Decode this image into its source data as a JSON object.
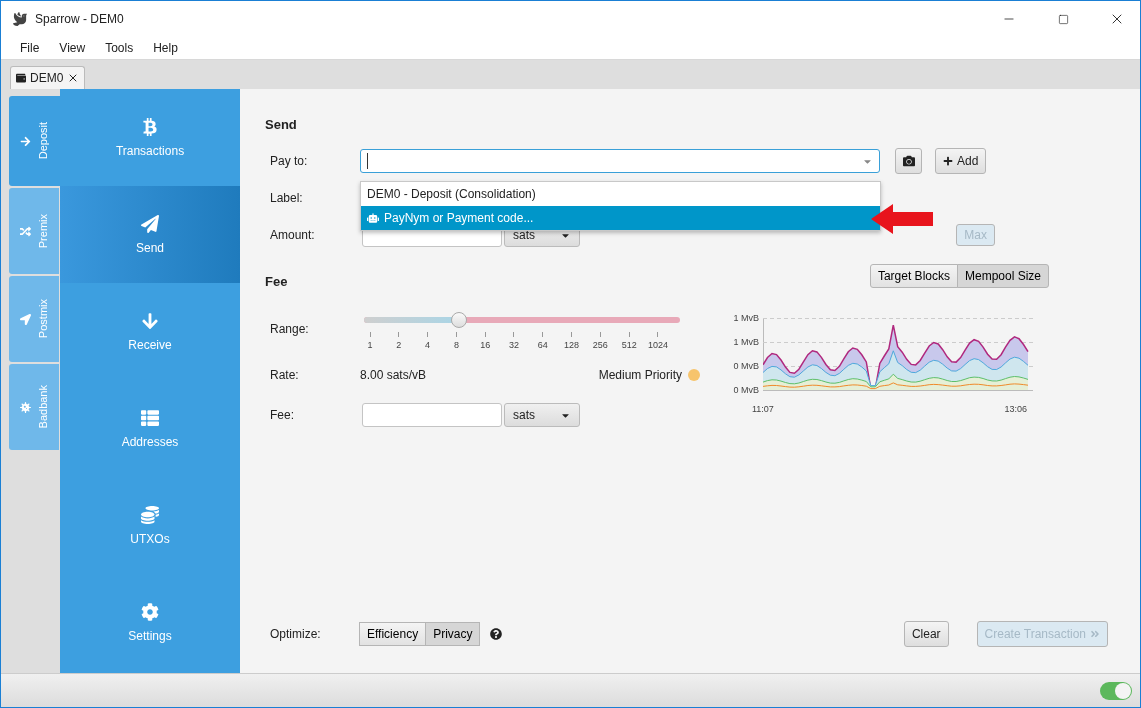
{
  "window": {
    "title": "Sparrow - DEM0"
  },
  "menu": [
    "File",
    "View",
    "Tools",
    "Help"
  ],
  "document_tabs": [
    {
      "label": "DEM0",
      "selected": true
    }
  ],
  "account_tabs": [
    {
      "label": "Deposit",
      "selected": true
    },
    {
      "label": "Premix",
      "selected": false
    },
    {
      "label": "Postmix",
      "selected": false
    },
    {
      "label": "Badbank",
      "selected": false
    }
  ],
  "nav": [
    {
      "label": "Transactions",
      "selected": false
    },
    {
      "label": "Send",
      "selected": true
    },
    {
      "label": "Receive",
      "selected": false
    },
    {
      "label": "Addresses",
      "selected": false
    },
    {
      "label": "UTXOs",
      "selected": false
    },
    {
      "label": "Settings",
      "selected": false
    }
  ],
  "send": {
    "title": "Send",
    "pay_to_label": "Pay to:",
    "add_button": "Add",
    "label_label": "Label:",
    "amount_label": "Amount:",
    "amount_unit": "sats",
    "max_button": "Max",
    "dropdown": [
      {
        "label": "DEM0 - Deposit (Consolidation)",
        "selected": false
      },
      {
        "label": "PayNym or Payment code...",
        "selected": true
      }
    ]
  },
  "fee": {
    "title": "Fee",
    "range_label": "Range:",
    "range_ticks": [
      "1",
      "2",
      "4",
      "8",
      "16",
      "32",
      "64",
      "128",
      "256",
      "512",
      "1024"
    ],
    "level": 0.3,
    "rate_label": "Rate:",
    "rate": "8.00 sats/vB",
    "priority": "Medium Priority",
    "priority_dot": {
      "color": "#f7c46c"
    },
    "fee_label": "Fee:",
    "fee_unit": "sats",
    "chart_modes": [
      {
        "label": "Target Blocks",
        "selected": false
      },
      {
        "label": "Mempool Size",
        "selected": true
      }
    ],
    "chart_y_labels": [
      "1 MvB",
      "1 MvB",
      "0 MvB",
      "0 MvB"
    ],
    "chart_x_labels": [
      "11:07",
      "13:06"
    ]
  },
  "optimize": {
    "label": "Optimize:",
    "options": [
      {
        "label": "Efficiency",
        "selected": false
      },
      {
        "label": "Privacy",
        "selected": true
      }
    ]
  },
  "actions": {
    "clear": "Clear",
    "create": "Create Transaction",
    "create_disabled": true
  },
  "status_bar": {
    "toggle_on": true
  }
}
